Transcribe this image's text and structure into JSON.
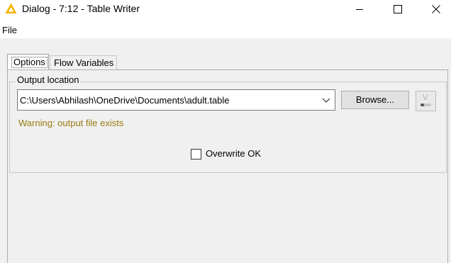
{
  "window": {
    "title": "Dialog - 7:12 - Table Writer",
    "app_icon": "knime-triangle-icon",
    "controls": [
      "minimize-icon",
      "maximize-icon",
      "close-icon"
    ]
  },
  "menu": {
    "items": [
      "File"
    ]
  },
  "tabs": [
    {
      "label": "Options",
      "selected": true
    },
    {
      "label": "Flow Variables",
      "selected": false
    }
  ],
  "output": {
    "group_title": "Output location",
    "path": "C:\\Users\\Abhilash\\OneDrive\\Documents\\adult.table",
    "browse_label": "Browse...",
    "warning": "Warning: output file exists",
    "warning_color": "#9a7b10"
  },
  "overwrite": {
    "label": "Overwrite OK",
    "checked": false
  },
  "colors": {
    "icon_accent": "#f5b400",
    "panel_bg": "#f0f0f0"
  }
}
